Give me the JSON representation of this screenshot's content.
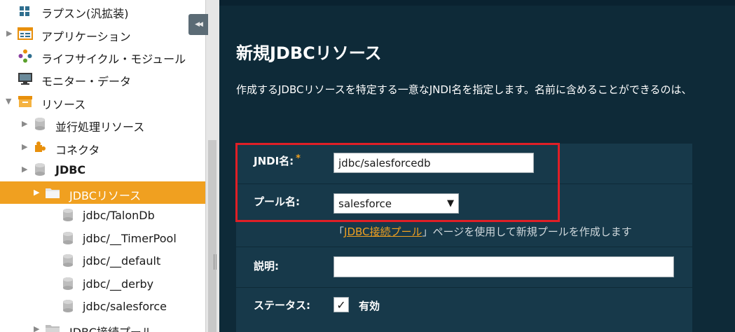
{
  "sidebar": {
    "items": [
      {
        "label": "ラプスン(汎拡装)",
        "icon": "grid-icon",
        "arrow": ""
      },
      {
        "label": "アプリケーション",
        "icon": "applications-icon",
        "arrow": "▶"
      },
      {
        "label": "ライフサイクル・モジュール",
        "icon": "lifecycle-icon",
        "arrow": ""
      },
      {
        "label": "モニター・データ",
        "icon": "monitor-icon",
        "arrow": ""
      },
      {
        "label": "リソース",
        "icon": "folder-icon",
        "arrow": "▼"
      },
      {
        "label": "並行処理リソース",
        "icon": "database-icon",
        "arrow": "▶"
      },
      {
        "label": "コネクタ",
        "icon": "puzzle-icon",
        "arrow": "▶"
      },
      {
        "label": "JDBC",
        "icon": "database-icon",
        "arrow": "▶"
      },
      {
        "label": "JDBCリソース",
        "icon": "folder-icon",
        "arrow": "▶"
      },
      {
        "label": "jdbc/TalonDb",
        "icon": "database-icon",
        "arrow": ""
      },
      {
        "label": "jdbc/__TimerPool",
        "icon": "database-icon",
        "arrow": ""
      },
      {
        "label": "jdbc/__default",
        "icon": "database-icon",
        "arrow": ""
      },
      {
        "label": "jdbc/__derby",
        "icon": "database-icon",
        "arrow": ""
      },
      {
        "label": "jdbc/salesforce",
        "icon": "database-icon",
        "arrow": ""
      },
      {
        "label": "JDBC接続プール",
        "icon": "folder-icon",
        "arrow": "▶"
      }
    ],
    "collapse_glyph": "◀◀"
  },
  "main": {
    "title": "新規JDBCリソース",
    "description": "作成するJDBCリソースを特定する一意なJNDI名を指定します。名前に含めることができるのは、"
  },
  "form": {
    "jndi_label": "JNDI名:",
    "required_mark": "*",
    "jndi_value": "jdbc/salesforcedb",
    "pool_label": "プール名:",
    "pool_selected": "salesforce",
    "hint_prefix": "「",
    "hint_link": "JDBC接続プール",
    "hint_suffix": "」ページを使用して新規プールを作成します",
    "desc_label": "説明:",
    "desc_value": "",
    "status_label": "ステータス:",
    "status_checkbox_label": "有効",
    "status_checked": true,
    "check_glyph": "✓"
  },
  "colors": {
    "accent": "#f0a020",
    "background": "#0e2a38",
    "panel": "#17394a",
    "highlight": "#e01f26"
  }
}
